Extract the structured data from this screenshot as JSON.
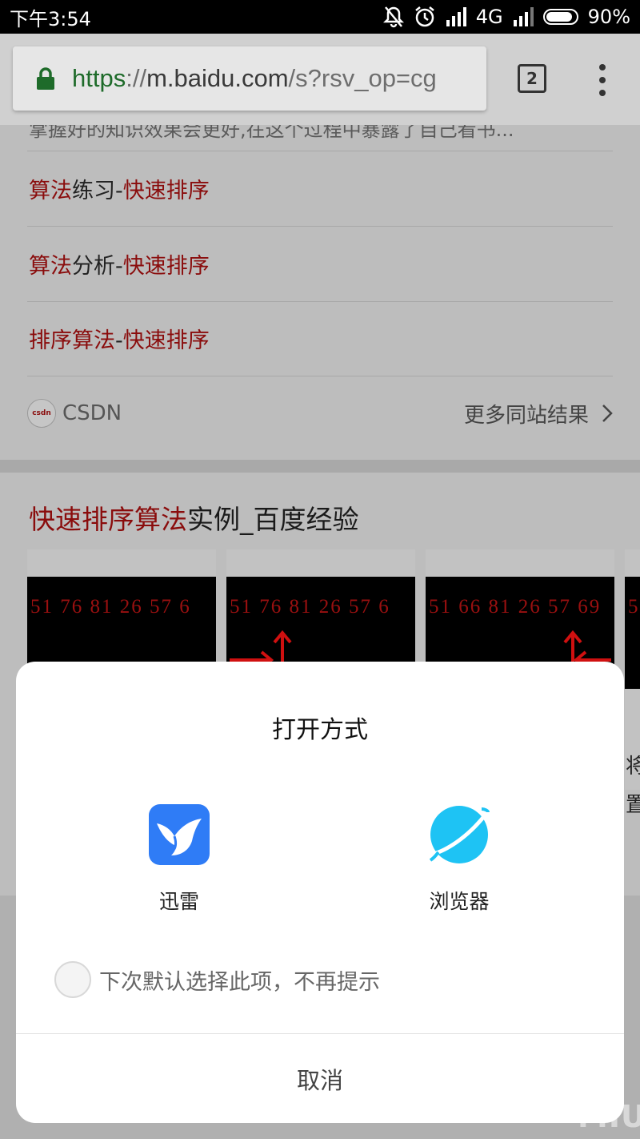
{
  "status_bar": {
    "time": "下午3:54",
    "network": "4G",
    "battery": "90%",
    "battery_level": 0.9
  },
  "browser": {
    "url_scheme": "https",
    "url_sep": "://",
    "url_host": "m.baidu.com",
    "url_path": "/s?rsv_op=cg",
    "tab_count": "2"
  },
  "page": {
    "clipped_text": "掌握好的知识效果会更好,在这个过程中暴露了自己看书...",
    "links": [
      {
        "hl1": "算法",
        "plain": "练习",
        "sep": "-",
        "hl2": "快速排序"
      },
      {
        "hl1": "算法",
        "plain": "分析",
        "sep": "-",
        "hl2": "快速排序"
      },
      {
        "hl1": "排序算法",
        "plain": "",
        "sep": "-",
        "hl2": "快速排序"
      }
    ],
    "site_logo_text": "csdn",
    "site_name": "CSDN",
    "more_results": "更多同站结果",
    "card2": {
      "hl": "快速排序算法",
      "rest": "实例_百度经验"
    },
    "thumbs": [
      {
        "numbers": "51 76 81 26 57 6"
      },
      {
        "numbers": "51 76 81 26 57 6"
      },
      {
        "numbers": "51 66 81 26 57 69"
      },
      {
        "numbers": "5"
      }
    ],
    "side_texts": [
      "将",
      "置"
    ]
  },
  "dialog": {
    "title": "打开方式",
    "apps": [
      {
        "label": "迅雷",
        "icon": "xunlei-bird-icon",
        "color": "#2f7cf6"
      },
      {
        "label": "浏览器",
        "icon": "browser-planet-icon",
        "color": "#1ec3f4"
      }
    ],
    "remember": "下次默认选择此项，不再提示",
    "cancel": "取消"
  },
  "watermark": "MIUI"
}
